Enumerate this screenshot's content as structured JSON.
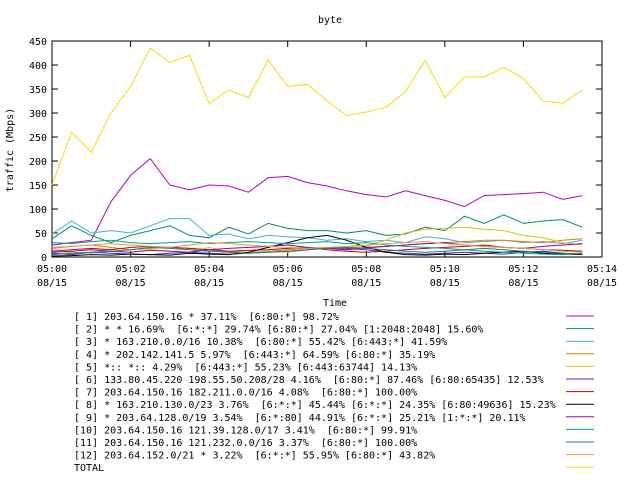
{
  "chart_data": {
    "type": "line",
    "title": "byte",
    "xlabel": "Time",
    "ylabel": "traffic (Mbps)",
    "ylim": [
      0,
      450
    ],
    "yticks": [
      0,
      50,
      100,
      150,
      200,
      250,
      300,
      350,
      400,
      450
    ],
    "xlim": [
      0,
      14
    ],
    "xticks": [
      {
        "t": 0,
        "time": "05:00",
        "date": "08/15"
      },
      {
        "t": 2,
        "time": "05:02",
        "date": "08/15"
      },
      {
        "t": 4,
        "time": "05:04",
        "date": "08/15"
      },
      {
        "t": 6,
        "time": "05:06",
        "date": "08/15"
      },
      {
        "t": 8,
        "time": "05:08",
        "date": "08/15"
      },
      {
        "t": 10,
        "time": "05:10",
        "date": "08/15"
      },
      {
        "t": 12,
        "time": "05:12",
        "date": "08/15"
      },
      {
        "t": 14,
        "time": "05:14",
        "date": "08/15"
      }
    ],
    "grid": false,
    "legend_position": "bottom",
    "x": [
      0,
      0.5,
      1,
      1.5,
      2,
      2.5,
      3,
      3.5,
      4,
      4.5,
      5,
      5.5,
      6,
      6.5,
      7,
      7.5,
      8,
      8.5,
      9,
      9.5,
      10,
      10.5,
      11,
      11.5,
      12,
      12.5,
      13,
      13.5
    ],
    "series": [
      {
        "name": "[ 1] 203.64.150.16 * 37.11%  [6:80:*] 98.72%",
        "color": "#bb00bb",
        "values": [
          25,
          30,
          35,
          115,
          170,
          205,
          150,
          140,
          150,
          148,
          135,
          165,
          168,
          155,
          148,
          138,
          130,
          125,
          138,
          128,
          118,
          105,
          128,
          130,
          132,
          135,
          120,
          128
        ]
      },
      {
        "name": "[ 2] * * 16.69%  [6:*:*] 29.74% [6:80:*] 27.04% [1:2048:2048] 15.60%",
        "color": "#008e74",
        "values": [
          38,
          65,
          45,
          30,
          45,
          55,
          65,
          45,
          40,
          62,
          48,
          70,
          60,
          55,
          55,
          50,
          55,
          45,
          48,
          62,
          55,
          85,
          70,
          88,
          70,
          75,
          78,
          62
        ]
      },
      {
        "name": "[ 3] * 163.210.0.0/16 10.38%  [6:80:*] 55.42% [6:443:*] 41.59%",
        "color": "#40b0d8",
        "values": [
          48,
          75,
          50,
          55,
          50,
          65,
          80,
          80,
          45,
          48,
          38,
          45,
          42,
          40,
          35,
          38,
          32,
          35,
          30,
          42,
          38,
          30,
          32,
          35,
          30,
          32,
          28,
          35
        ]
      },
      {
        "name": "[ 4] * 202.142.141.5 5.97%  [6:443:*] 64.59% [6:80:*] 35.19%",
        "color": "#e08000",
        "values": [
          18,
          22,
          25,
          20,
          15,
          18,
          20,
          18,
          15,
          12,
          10,
          12,
          15,
          18,
          20,
          15,
          18,
          22,
          25,
          28,
          30,
          32,
          35,
          35,
          32,
          30,
          35,
          38
        ]
      },
      {
        "name": "[ 5] *:: *:: 4.29%  [6:443:*] 55.23% [6:443:63744] 14.13%",
        "color": "#e0c000",
        "values": [
          5,
          10,
          8,
          12,
          10,
          15,
          12,
          10,
          20,
          10,
          10,
          12,
          10,
          15,
          18,
          20,
          22,
          35,
          50,
          58,
          60,
          62,
          58,
          55,
          45,
          40,
          30,
          25
        ]
      },
      {
        "name": "[ 6] 133.80.45.220 198.55.50.208/28 4.16%  [6:80:*] 87.46% [6:80:65435] 12.53%",
        "color": "#3030e0",
        "values": [
          8,
          5,
          10,
          8,
          6,
          5,
          8,
          10,
          8,
          6,
          8,
          10,
          12,
          15,
          20,
          18,
          15,
          10,
          8,
          6,
          8,
          10,
          8,
          6,
          10,
          12,
          8,
          6
        ]
      },
      {
        "name": "[ 7] 203.64.150.16 182.211.0.0/16 4.08%  [6:80:*] 100.00%",
        "color": "#d00000",
        "values": [
          12,
          15,
          18,
          15,
          20,
          22,
          20,
          18,
          15,
          12,
          14,
          15,
          18,
          20,
          15,
          12,
          10,
          12,
          15,
          18,
          20,
          22,
          25,
          20,
          18,
          15,
          14,
          12
        ]
      },
      {
        "name": "[ 8] * 163.210.130.0/23 3.76%  [6:*:*] 45.44% [6:*:*] 24.35% [6:80:49636] 15.23%",
        "color": "#000000",
        "values": [
          2,
          3,
          5,
          4,
          6,
          5,
          4,
          8,
          6,
          5,
          10,
          20,
          30,
          40,
          45,
          35,
          20,
          10,
          5,
          4,
          6,
          5,
          8,
          10,
          12,
          8,
          6,
          5
        ]
      },
      {
        "name": "[ 9] * 203.64.128.0/19 3.54%  [6:*:80] 44.91% [6:*:*] 25.21% [1:*:*] 20.11%",
        "color": "#9000c0",
        "values": [
          10,
          12,
          15,
          12,
          10,
          14,
          12,
          10,
          15,
          18,
          20,
          22,
          25,
          20,
          18,
          15,
          20,
          22,
          25,
          28,
          30,
          25,
          22,
          20,
          18,
          22,
          25,
          28
        ]
      },
      {
        "name": "[10] 203.64.150.16 121.39.128.0/17 3.41%  [6:80:*] 99.91%",
        "color": "#00a090",
        "values": [
          30,
          28,
          32,
          35,
          30,
          28,
          30,
          32,
          28,
          30,
          32,
          30,
          28,
          30,
          32,
          28,
          30,
          25,
          22,
          20,
          18,
          15,
          12,
          10,
          8,
          6,
          5,
          8
        ]
      },
      {
        "name": "[11] 203.64.150.16 121.232.0.0/16 3.37%  [6:80:*] 100.00%",
        "color": "#208080",
        "values": [
          5,
          8,
          10,
          12,
          15,
          20,
          18,
          15,
          12,
          10,
          8,
          10,
          12,
          15,
          18,
          20,
          18,
          15,
          12,
          10,
          12,
          15,
          18,
          15,
          12,
          10,
          8,
          6
        ]
      },
      {
        "name": "[12] 203.64.152.0/21 * 3.22%  [6:*:*] 55.95% [6:80:*] 43.82%",
        "color": "#e0a040",
        "values": [
          20,
          22,
          25,
          28,
          25,
          22,
          20,
          25,
          30,
          28,
          25,
          22,
          20,
          18,
          20,
          22,
          25,
          28,
          30,
          32,
          28,
          25,
          22,
          20,
          18,
          15,
          12,
          10
        ]
      },
      {
        "name": "TOTAL",
        "color": "#ffd800",
        "values": [
          150,
          260,
          218,
          300,
          355,
          435,
          405,
          420,
          320,
          348,
          332,
          410,
          355,
          360,
          325,
          295,
          302,
          312,
          345,
          410,
          332,
          375,
          375,
          395,
          372,
          325,
          320,
          348
        ]
      }
    ]
  }
}
